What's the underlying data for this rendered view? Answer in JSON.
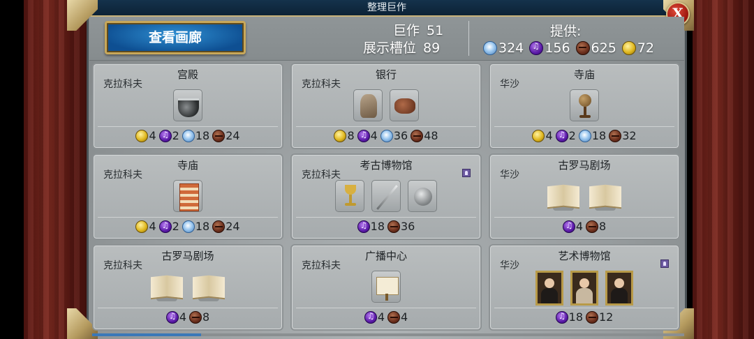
{
  "window": {
    "title": "整理巨作",
    "close_label": "X"
  },
  "header": {
    "gallery_button": "查看画廊",
    "great_works_label": "巨作",
    "great_works_value": "51",
    "slots_label": "展示槽位",
    "slots_value": "89",
    "supply_label": "提供:",
    "supply": [
      {
        "icon": "tourism-icon",
        "value": "324"
      },
      {
        "icon": "culture-icon",
        "value": "156"
      },
      {
        "icon": "production-icon",
        "value": "625"
      },
      {
        "icon": "gold-icon",
        "value": "72"
      }
    ]
  },
  "buildings": [
    {
      "name": "宫殿",
      "city": "克拉科夫",
      "info": false,
      "items": [
        "cauldron"
      ],
      "yields": [
        {
          "icon": "gold-icon",
          "value": "4"
        },
        {
          "icon": "culture-icon",
          "value": "2"
        },
        {
          "icon": "tourism-icon",
          "value": "18"
        },
        {
          "icon": "production-icon",
          "value": "24"
        }
      ]
    },
    {
      "name": "银行",
      "city": "克拉科夫",
      "info": false,
      "items": [
        "cloak",
        "sandal"
      ],
      "yields": [
        {
          "icon": "gold-icon",
          "value": "8"
        },
        {
          "icon": "culture-icon",
          "value": "4"
        },
        {
          "icon": "tourism-icon",
          "value": "36"
        },
        {
          "icon": "production-icon",
          "value": "48"
        }
      ]
    },
    {
      "name": "寺庙",
      "city": "华沙",
      "info": false,
      "items": [
        "globe"
      ],
      "yields": [
        {
          "icon": "gold-icon",
          "value": "4"
        },
        {
          "icon": "culture-icon",
          "value": "2"
        },
        {
          "icon": "tourism-icon",
          "value": "18"
        },
        {
          "icon": "production-icon",
          "value": "32"
        }
      ]
    },
    {
      "name": "寺庙",
      "city": "克拉科夫",
      "info": false,
      "items": [
        "tapestry"
      ],
      "yields": [
        {
          "icon": "gold-icon",
          "value": "4"
        },
        {
          "icon": "culture-icon",
          "value": "2"
        },
        {
          "icon": "tourism-icon",
          "value": "18"
        },
        {
          "icon": "production-icon",
          "value": "24"
        }
      ]
    },
    {
      "name": "考古博物馆",
      "city": "克拉科夫",
      "info": true,
      "items": [
        "chalice",
        "sword",
        "coin"
      ],
      "yields": [
        {
          "icon": "culture-icon",
          "value": "18"
        },
        {
          "icon": "production-icon",
          "value": "36"
        }
      ]
    },
    {
      "name": "古罗马剧场",
      "city": "华沙",
      "info": false,
      "items": [
        "book",
        "book"
      ],
      "yields": [
        {
          "icon": "culture-icon",
          "value": "4"
        },
        {
          "icon": "production-icon",
          "value": "8"
        }
      ]
    },
    {
      "name": "古罗马剧场",
      "city": "克拉科夫",
      "info": false,
      "items": [
        "book",
        "book"
      ],
      "yields": [
        {
          "icon": "culture-icon",
          "value": "4"
        },
        {
          "icon": "production-icon",
          "value": "8"
        }
      ]
    },
    {
      "name": "广播中心",
      "city": "克拉科夫",
      "info": false,
      "items": [
        "scroll"
      ],
      "yields": [
        {
          "icon": "culture-icon",
          "value": "4"
        },
        {
          "icon": "production-icon",
          "value": "4"
        }
      ]
    },
    {
      "name": "艺术博物馆",
      "city": "华沙",
      "info": true,
      "items": [
        "painting",
        "painting-light",
        "painting"
      ],
      "yields": [
        {
          "icon": "culture-icon",
          "value": "18"
        },
        {
          "icon": "production-icon",
          "value": "12"
        }
      ]
    }
  ]
}
